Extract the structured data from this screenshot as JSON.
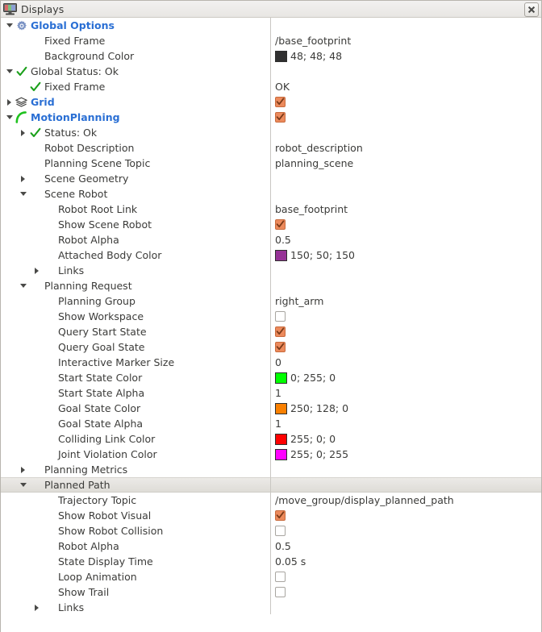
{
  "window": {
    "title": "Displays",
    "icon": "display-monitor-icon",
    "close_label": "close"
  },
  "colors": {
    "link_blue": "#2a6fd4",
    "check_orange": "#ec8a5c",
    "text": "#3b3b39"
  },
  "tree": {
    "rows": [
      {
        "indent": 0,
        "expander": "down",
        "icon": "gear-icon",
        "label": "Global Options",
        "name": "global-options",
        "bold": true,
        "value_type": "none"
      },
      {
        "indent": 1,
        "expander": "none",
        "icon": "none",
        "label": "Fixed Frame",
        "name": "fixed-frame",
        "bold": false,
        "value_type": "text",
        "value": "/base_footprint"
      },
      {
        "indent": 1,
        "expander": "none",
        "icon": "none",
        "label": "Background Color",
        "name": "background-color",
        "bold": false,
        "value_type": "color",
        "value": "48; 48; 48",
        "swatch": "#303030"
      },
      {
        "indent": 0,
        "expander": "down",
        "icon": "check-green-icon",
        "label": "Global Status: Ok",
        "name": "global-status",
        "bold": false,
        "value_type": "none"
      },
      {
        "indent": 1,
        "expander": "none",
        "icon": "check-green-icon",
        "label": "Fixed Frame",
        "name": "global-status-fixed-frame",
        "bold": false,
        "value_type": "text",
        "value": "OK"
      },
      {
        "indent": 0,
        "expander": "right",
        "icon": "layers-grid-icon",
        "label": "Grid",
        "name": "grid",
        "bold": true,
        "value_type": "checkbox",
        "checked": true
      },
      {
        "indent": 0,
        "expander": "down",
        "icon": "green-arc-icon",
        "label": "MotionPlanning",
        "name": "motion-planning",
        "bold": true,
        "value_type": "checkbox",
        "checked": true
      },
      {
        "indent": 1,
        "expander": "right",
        "icon": "check-green-icon",
        "label": "Status: Ok",
        "name": "motion-planning-status",
        "bold": false,
        "value_type": "none"
      },
      {
        "indent": 1,
        "expander": "none",
        "icon": "none",
        "label": "Robot Description",
        "name": "robot-description",
        "bold": false,
        "value_type": "text",
        "value": "robot_description"
      },
      {
        "indent": 1,
        "expander": "none",
        "icon": "none",
        "label": "Planning Scene Topic",
        "name": "planning-scene-topic",
        "bold": false,
        "value_type": "text",
        "value": "planning_scene"
      },
      {
        "indent": 1,
        "expander": "right",
        "icon": "none",
        "label": "Scene Geometry",
        "name": "scene-geometry",
        "bold": false,
        "value_type": "none"
      },
      {
        "indent": 1,
        "expander": "down",
        "icon": "none",
        "label": "Scene Robot",
        "name": "scene-robot",
        "bold": false,
        "value_type": "none"
      },
      {
        "indent": 2,
        "expander": "none",
        "icon": "none",
        "label": "Robot Root Link",
        "name": "robot-root-link",
        "bold": false,
        "value_type": "text",
        "value": "base_footprint"
      },
      {
        "indent": 2,
        "expander": "none",
        "icon": "none",
        "label": "Show Scene Robot",
        "name": "show-scene-robot",
        "bold": false,
        "value_type": "checkbox",
        "checked": true
      },
      {
        "indent": 2,
        "expander": "none",
        "icon": "none",
        "label": "Robot Alpha",
        "name": "scene-robot-alpha",
        "bold": false,
        "value_type": "text",
        "value": "0.5"
      },
      {
        "indent": 2,
        "expander": "none",
        "icon": "none",
        "label": "Attached Body Color",
        "name": "attached-body-color",
        "bold": false,
        "value_type": "color",
        "value": "150; 50; 150",
        "swatch": "#963296"
      },
      {
        "indent": 2,
        "expander": "right",
        "icon": "none",
        "label": "Links",
        "name": "scene-robot-links",
        "bold": false,
        "value_type": "none"
      },
      {
        "indent": 1,
        "expander": "down",
        "icon": "none",
        "label": "Planning Request",
        "name": "planning-request",
        "bold": false,
        "value_type": "none"
      },
      {
        "indent": 2,
        "expander": "none",
        "icon": "none",
        "label": "Planning Group",
        "name": "planning-group",
        "bold": false,
        "value_type": "text",
        "value": "right_arm"
      },
      {
        "indent": 2,
        "expander": "none",
        "icon": "none",
        "label": "Show Workspace",
        "name": "show-workspace",
        "bold": false,
        "value_type": "checkbox",
        "checked": false
      },
      {
        "indent": 2,
        "expander": "none",
        "icon": "none",
        "label": "Query Start State",
        "name": "query-start-state",
        "bold": false,
        "value_type": "checkbox",
        "checked": true
      },
      {
        "indent": 2,
        "expander": "none",
        "icon": "none",
        "label": "Query Goal State",
        "name": "query-goal-state",
        "bold": false,
        "value_type": "checkbox",
        "checked": true
      },
      {
        "indent": 2,
        "expander": "none",
        "icon": "none",
        "label": "Interactive Marker Size",
        "name": "interactive-marker-size",
        "bold": false,
        "value_type": "text",
        "value": "0"
      },
      {
        "indent": 2,
        "expander": "none",
        "icon": "none",
        "label": "Start State Color",
        "name": "start-state-color",
        "bold": false,
        "value_type": "color",
        "value": "0; 255; 0",
        "swatch": "#00ff00"
      },
      {
        "indent": 2,
        "expander": "none",
        "icon": "none",
        "label": "Start State Alpha",
        "name": "start-state-alpha",
        "bold": false,
        "value_type": "text",
        "value": "1"
      },
      {
        "indent": 2,
        "expander": "none",
        "icon": "none",
        "label": "Goal State Color",
        "name": "goal-state-color",
        "bold": false,
        "value_type": "color",
        "value": "250; 128; 0",
        "swatch": "#fa8000"
      },
      {
        "indent": 2,
        "expander": "none",
        "icon": "none",
        "label": "Goal State Alpha",
        "name": "goal-state-alpha",
        "bold": false,
        "value_type": "text",
        "value": "1"
      },
      {
        "indent": 2,
        "expander": "none",
        "icon": "none",
        "label": "Colliding Link Color",
        "name": "colliding-link-color",
        "bold": false,
        "value_type": "color",
        "value": "255; 0; 0",
        "swatch": "#ff0000"
      },
      {
        "indent": 2,
        "expander": "none",
        "icon": "none",
        "label": "Joint Violation Color",
        "name": "joint-violation-color",
        "bold": false,
        "value_type": "color",
        "value": "255; 0; 255",
        "swatch": "#ff00ff"
      },
      {
        "indent": 1,
        "expander": "right",
        "icon": "none",
        "label": "Planning Metrics",
        "name": "planning-metrics",
        "bold": false,
        "value_type": "none"
      },
      {
        "indent": 1,
        "expander": "down",
        "icon": "none",
        "label": "Planned Path",
        "name": "planned-path",
        "bold": false,
        "value_type": "none",
        "selected": true
      },
      {
        "indent": 2,
        "expander": "none",
        "icon": "none",
        "label": "Trajectory Topic",
        "name": "trajectory-topic",
        "bold": false,
        "value_type": "text",
        "value": "/move_group/display_planned_path"
      },
      {
        "indent": 2,
        "expander": "none",
        "icon": "none",
        "label": "Show Robot Visual",
        "name": "show-robot-visual",
        "bold": false,
        "value_type": "checkbox",
        "checked": true
      },
      {
        "indent": 2,
        "expander": "none",
        "icon": "none",
        "label": "Show Robot Collision",
        "name": "show-robot-collision",
        "bold": false,
        "value_type": "checkbox",
        "checked": false
      },
      {
        "indent": 2,
        "expander": "none",
        "icon": "none",
        "label": "Robot Alpha",
        "name": "planned-path-robot-alpha",
        "bold": false,
        "value_type": "text",
        "value": "0.5"
      },
      {
        "indent": 2,
        "expander": "none",
        "icon": "none",
        "label": "State Display Time",
        "name": "state-display-time",
        "bold": false,
        "value_type": "text",
        "value": "0.05 s"
      },
      {
        "indent": 2,
        "expander": "none",
        "icon": "none",
        "label": "Loop Animation",
        "name": "loop-animation",
        "bold": false,
        "value_type": "checkbox",
        "checked": false
      },
      {
        "indent": 2,
        "expander": "none",
        "icon": "none",
        "label": "Show Trail",
        "name": "show-trail",
        "bold": false,
        "value_type": "checkbox",
        "checked": false
      },
      {
        "indent": 2,
        "expander": "right",
        "icon": "none",
        "label": "Links",
        "name": "planned-path-links",
        "bold": false,
        "value_type": "none"
      }
    ]
  }
}
